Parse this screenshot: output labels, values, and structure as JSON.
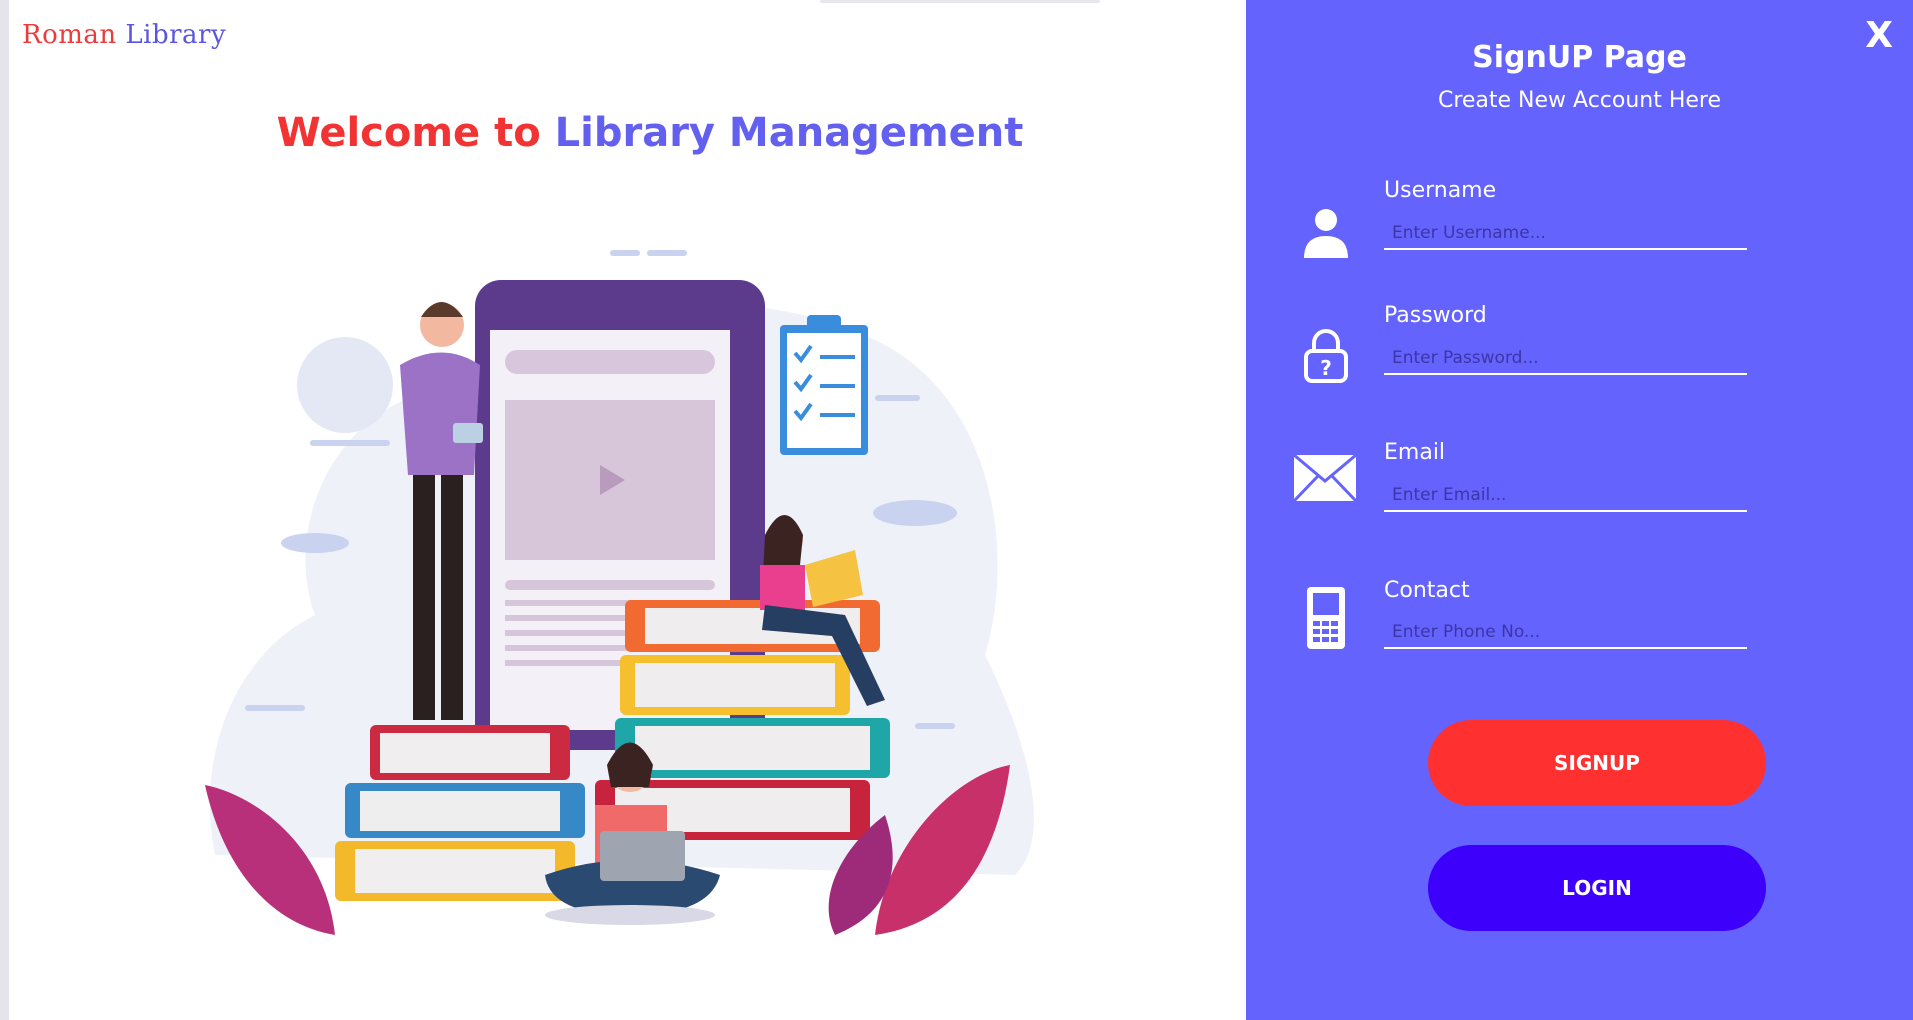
{
  "brand": {
    "word1": "Roman",
    "word2": "Library"
  },
  "welcome": {
    "part1": "Welcome to",
    "part2": "Library Management"
  },
  "panel": {
    "close_label": "X",
    "title": "SignUP Page",
    "subtitle": "Create New Account Here",
    "fields": [
      {
        "label": "Username",
        "placeholder": "Enter Username...",
        "icon": "user-icon"
      },
      {
        "label": "Password",
        "placeholder": "Enter Password...",
        "icon": "lock-icon"
      },
      {
        "label": "Email",
        "placeholder": "Enter Email...",
        "icon": "envelope-icon"
      },
      {
        "label": "Contact",
        "placeholder": "Enter Phone No...",
        "icon": "phone-icon"
      }
    ],
    "signup_label": "SIGNUP",
    "login_label": "LOGIN"
  },
  "colors": {
    "panel_bg": "#6563fd",
    "signup_button": "#ff3030",
    "login_button": "#3d00fa",
    "brand_red": "#ee3a3a",
    "brand_blue": "#5b56e0"
  }
}
